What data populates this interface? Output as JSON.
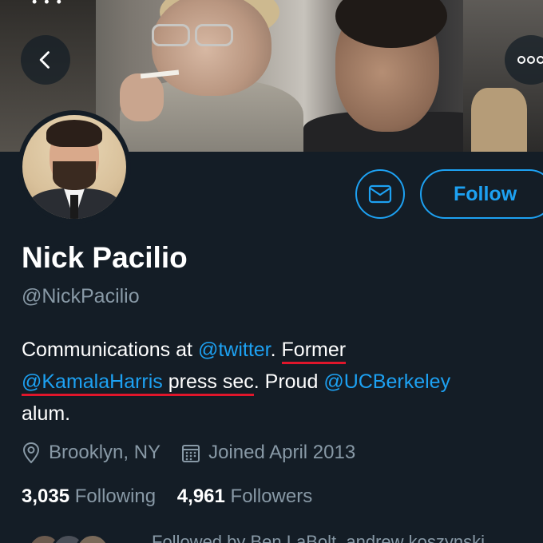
{
  "status_bar": {
    "dots": "• • •"
  },
  "header": {
    "back_label": "Back",
    "more_label": "More"
  },
  "profile": {
    "name": "Nick Pacilio",
    "handle": "@NickPacilio",
    "follow_label": "Follow",
    "bio": {
      "part1": "Communications at ",
      "mention1": "@twitter",
      "part2": ". ",
      "underlined1": "Former",
      "mention2": "@KamalaHarris",
      "underlined2": " press sec",
      "part3": ". Proud ",
      "mention3": "@UCBerkeley",
      "part4": "alum."
    },
    "location": "Brooklyn, NY",
    "joined": "Joined April 2013",
    "following_count": "3,035",
    "following_label": "Following",
    "followers_count": "4,961",
    "followers_label": "Followers",
    "followed_by": "Followed by Ben LaBolt, andrew koszynski"
  },
  "colors": {
    "background": "#141d26",
    "accent": "#1da1f2",
    "muted": "#8899a6",
    "annotation_underline": "#e0162b"
  },
  "icons": {
    "back": "chevron-left-icon",
    "more": "more-horizontal-icon",
    "mail": "envelope-icon",
    "location": "location-pin-icon",
    "calendar": "calendar-icon"
  }
}
